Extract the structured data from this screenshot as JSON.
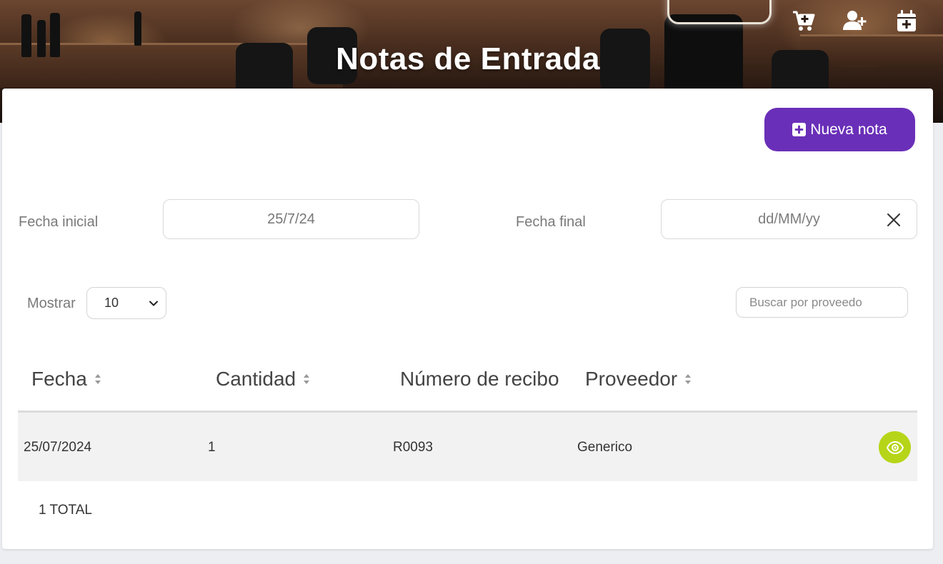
{
  "header": {
    "title": "Notas de Entrada",
    "icons": [
      "cart-plus-icon",
      "user-plus-icon",
      "calendar-plus-icon"
    ]
  },
  "toolbar": {
    "new_note_label": "Nueva nota"
  },
  "filters": {
    "start_date_label": "Fecha inicial",
    "start_date_value": "25/7/24",
    "end_date_label": "Fecha final",
    "end_date_placeholder": "dd/MM/yy"
  },
  "list_controls": {
    "show_label": "Mostrar",
    "page_size": "10",
    "search_placeholder": "Buscar por proveedo"
  },
  "table": {
    "columns": [
      "Fecha",
      "Cantidad",
      "Número de recibo",
      "Proveedor"
    ],
    "rows": [
      {
        "fecha": "25/07/2024",
        "cantidad": "1",
        "recibo": "R0093",
        "proveedor": "Generico"
      }
    ]
  },
  "footer": {
    "total_label": "1 TOTAL"
  },
  "colors": {
    "primary": "#6a2fb8",
    "view_button": "#b6d518",
    "row_background": "#f2f2f2"
  }
}
